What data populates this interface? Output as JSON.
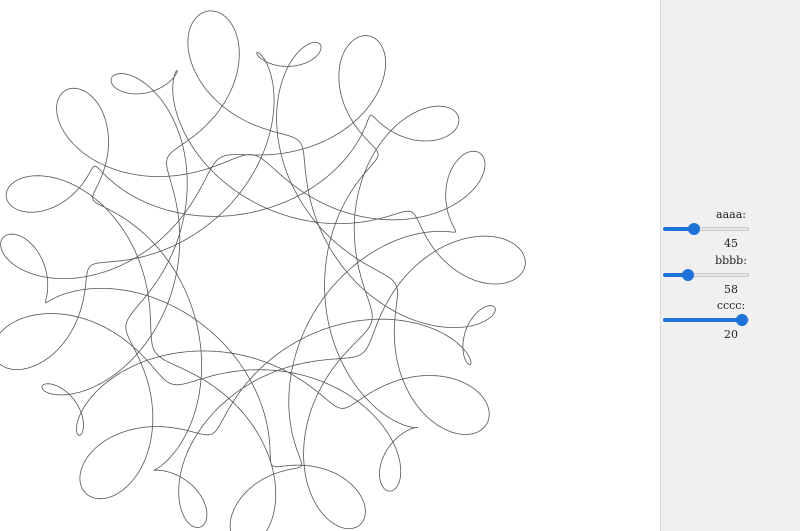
{
  "colors": {
    "accent": "#1f72d8",
    "panel_background": "#f0f0f0",
    "curve_stroke": "#555555"
  },
  "drawing": {
    "description_icon": "spirograph-curve"
  },
  "controls": [
    {
      "label": "aaaa:",
      "value": "45",
      "fraction": 0.34
    },
    {
      "label": "bbbb:",
      "value": "58",
      "fraction": 0.26
    },
    {
      "label": "cccc:",
      "value": "20",
      "fraction": 0.99
    }
  ]
}
